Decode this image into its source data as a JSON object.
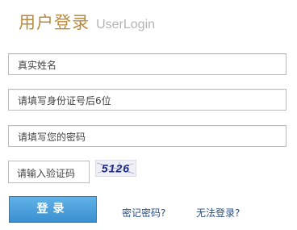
{
  "header": {
    "title_cn": "用户登录",
    "title_en": "UserLogin"
  },
  "form": {
    "name_placeholder": "真实姓名",
    "id_placeholder": "请填写身份证号后6位",
    "password_placeholder": "请填写您的密码",
    "captcha_placeholder": "请输入验证码",
    "captcha_text": "5126",
    "login_label": "登录"
  },
  "links": {
    "forgot_password": "密记密码?",
    "cannot_login": "无法登录?"
  },
  "colors": {
    "title": "#b88a3e",
    "subtitle": "#b4b4b4",
    "button": "#4a9fdc",
    "link": "#2a4f80"
  }
}
